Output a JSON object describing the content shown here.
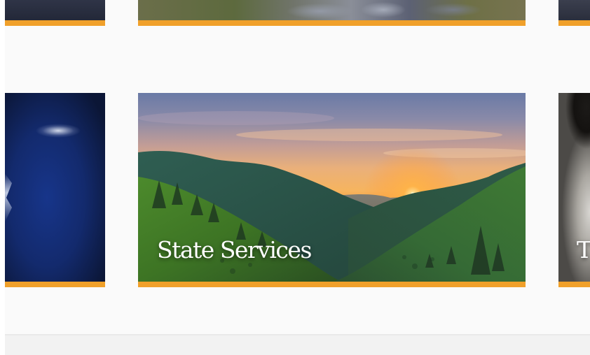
{
  "colors": {
    "accent": "#f0a02a",
    "background": "#fafafa",
    "title_text": "#ffffff"
  },
  "cards": {
    "top_row": {
      "left": {
        "title": ""
      },
      "center": {
        "title": ""
      },
      "right": {
        "title": ""
      }
    },
    "middle_row": {
      "left": {
        "title": ""
      },
      "center": {
        "title": "State Services"
      },
      "right": {
        "title": "T"
      }
    }
  }
}
